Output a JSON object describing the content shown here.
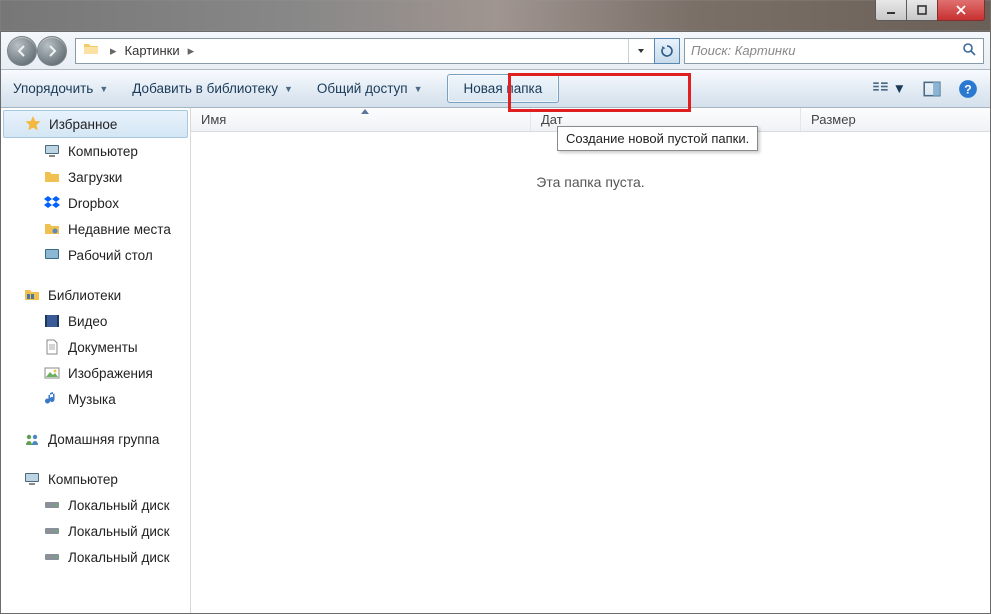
{
  "address": {
    "folder_name": "Картинки"
  },
  "search": {
    "placeholder": "Поиск: Картинки"
  },
  "toolbar": {
    "organize": "Упорядочить",
    "add_to_library": "Добавить в библиотеку",
    "share": "Общий доступ",
    "new_folder": "Новая папка"
  },
  "tooltip": {
    "new_folder": "Создание новой пустой папки."
  },
  "columns": {
    "name": "Имя",
    "date_partial": "Дат",
    "size": "Размер"
  },
  "content": {
    "empty": "Эта папка пуста."
  },
  "sidebar": {
    "favorites": {
      "header": "Избранное",
      "items": [
        {
          "label": "Компьютер",
          "icon": "computer"
        },
        {
          "label": "Загрузки",
          "icon": "folder"
        },
        {
          "label": "Dropbox",
          "icon": "dropbox"
        },
        {
          "label": "Недавние места",
          "icon": "pin"
        },
        {
          "label": "Рабочий стол",
          "icon": "desktop"
        }
      ]
    },
    "libraries": {
      "header": "Библиотеки",
      "items": [
        {
          "label": "Видео",
          "icon": "video"
        },
        {
          "label": "Документы",
          "icon": "doc"
        },
        {
          "label": "Изображения",
          "icon": "image"
        },
        {
          "label": "Музыка",
          "icon": "music"
        }
      ]
    },
    "homegroup": {
      "header": "Домашняя группа"
    },
    "computer": {
      "header": "Компьютер",
      "items": [
        {
          "label": "Локальный диск",
          "icon": "disk"
        },
        {
          "label": "Локальный диск",
          "icon": "disk"
        },
        {
          "label": "Локальный диск",
          "icon": "disk"
        }
      ]
    }
  }
}
